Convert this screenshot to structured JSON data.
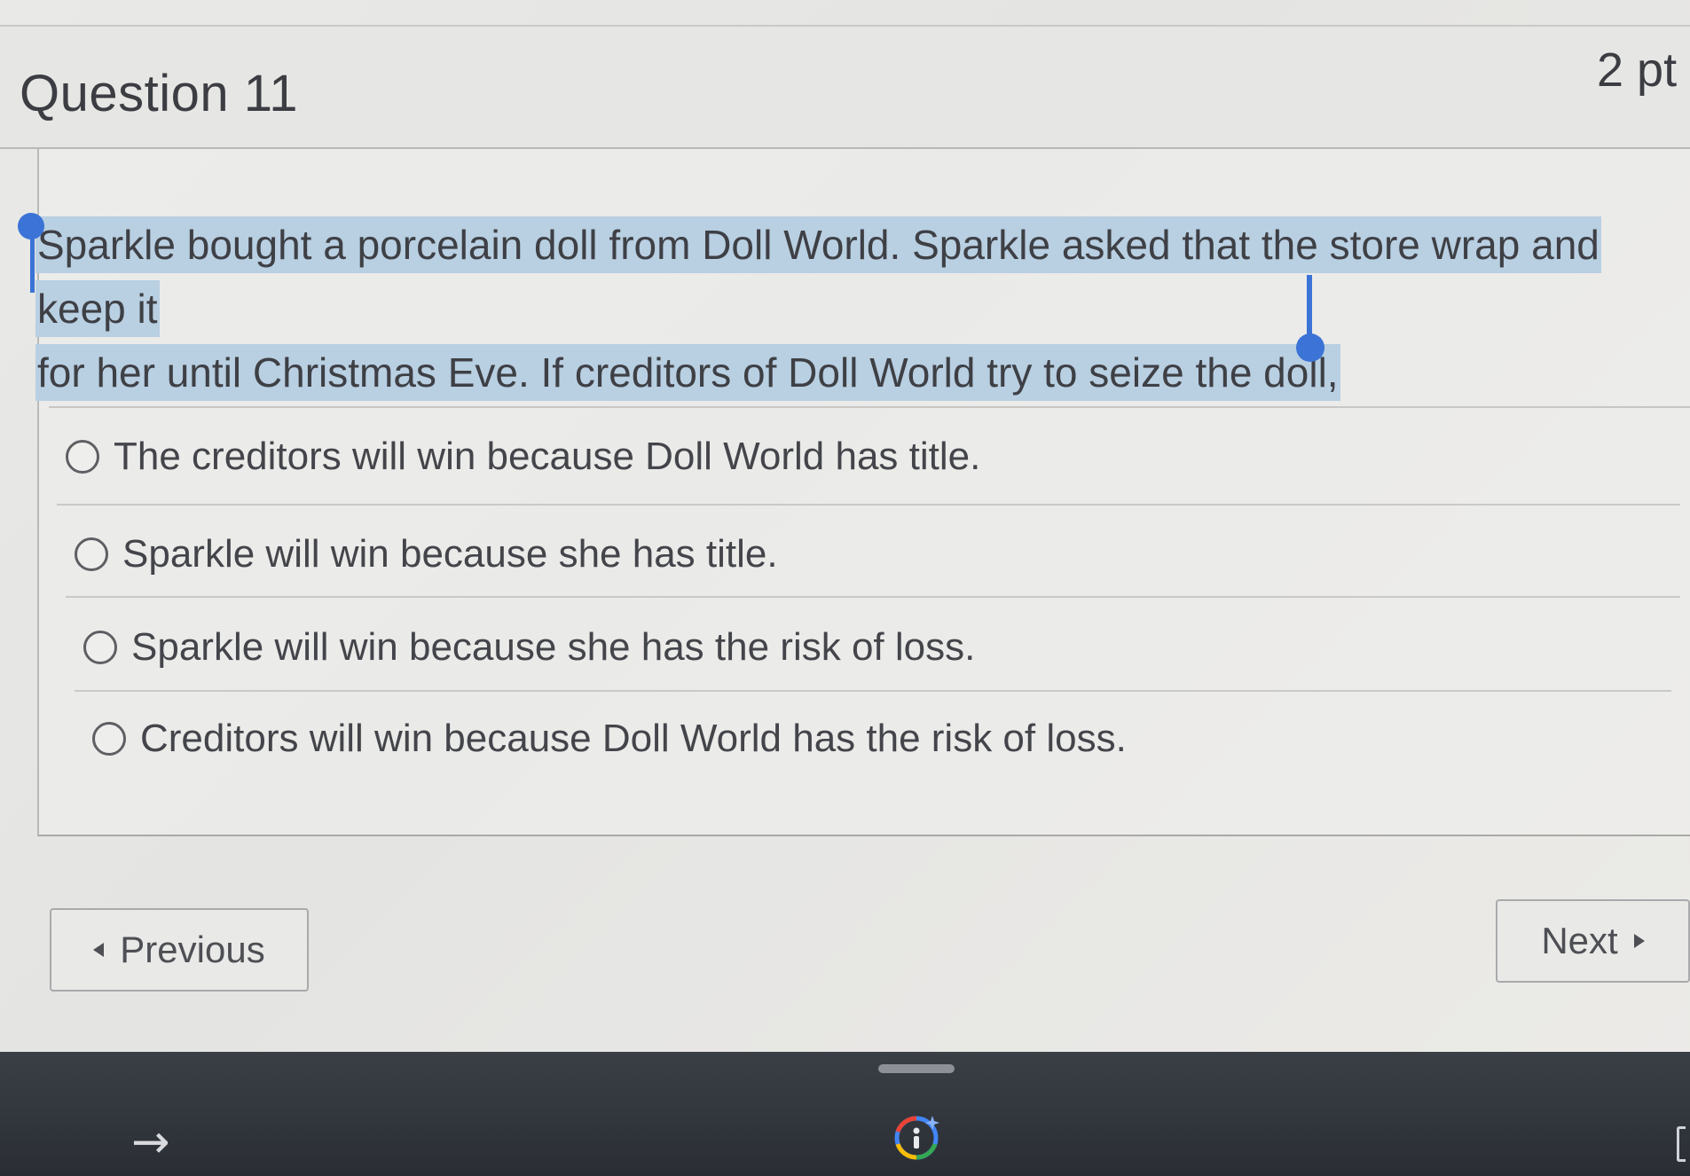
{
  "question": {
    "title": "Question 11",
    "points": "2 pt",
    "prompt_line1": "Sparkle bought a porcelain doll from Doll World. Sparkle asked that the store wrap and keep it",
    "prompt_line2": "for her until Christmas Eve. If creditors of Doll World try to seize the doll,"
  },
  "options": [
    {
      "label": "The creditors will win because Doll World has title.",
      "selected": false
    },
    {
      "label": "Sparkle will win because she has title.",
      "selected": false
    },
    {
      "label": "Sparkle will win because she has the risk of loss.",
      "selected": false
    },
    {
      "label": "Creditors will win because Doll World has the risk of loss.",
      "selected": false
    }
  ],
  "navigation": {
    "previous_label": "Previous",
    "next_label": "Next"
  },
  "taskbar": {
    "icons": [
      "arrow-right-icon",
      "google-lens-icon",
      "window-edge-icon"
    ]
  },
  "colors": {
    "selection_highlight": "#b9cfe2",
    "selection_handle": "#3b73d6",
    "taskbar": "#2f343a"
  }
}
